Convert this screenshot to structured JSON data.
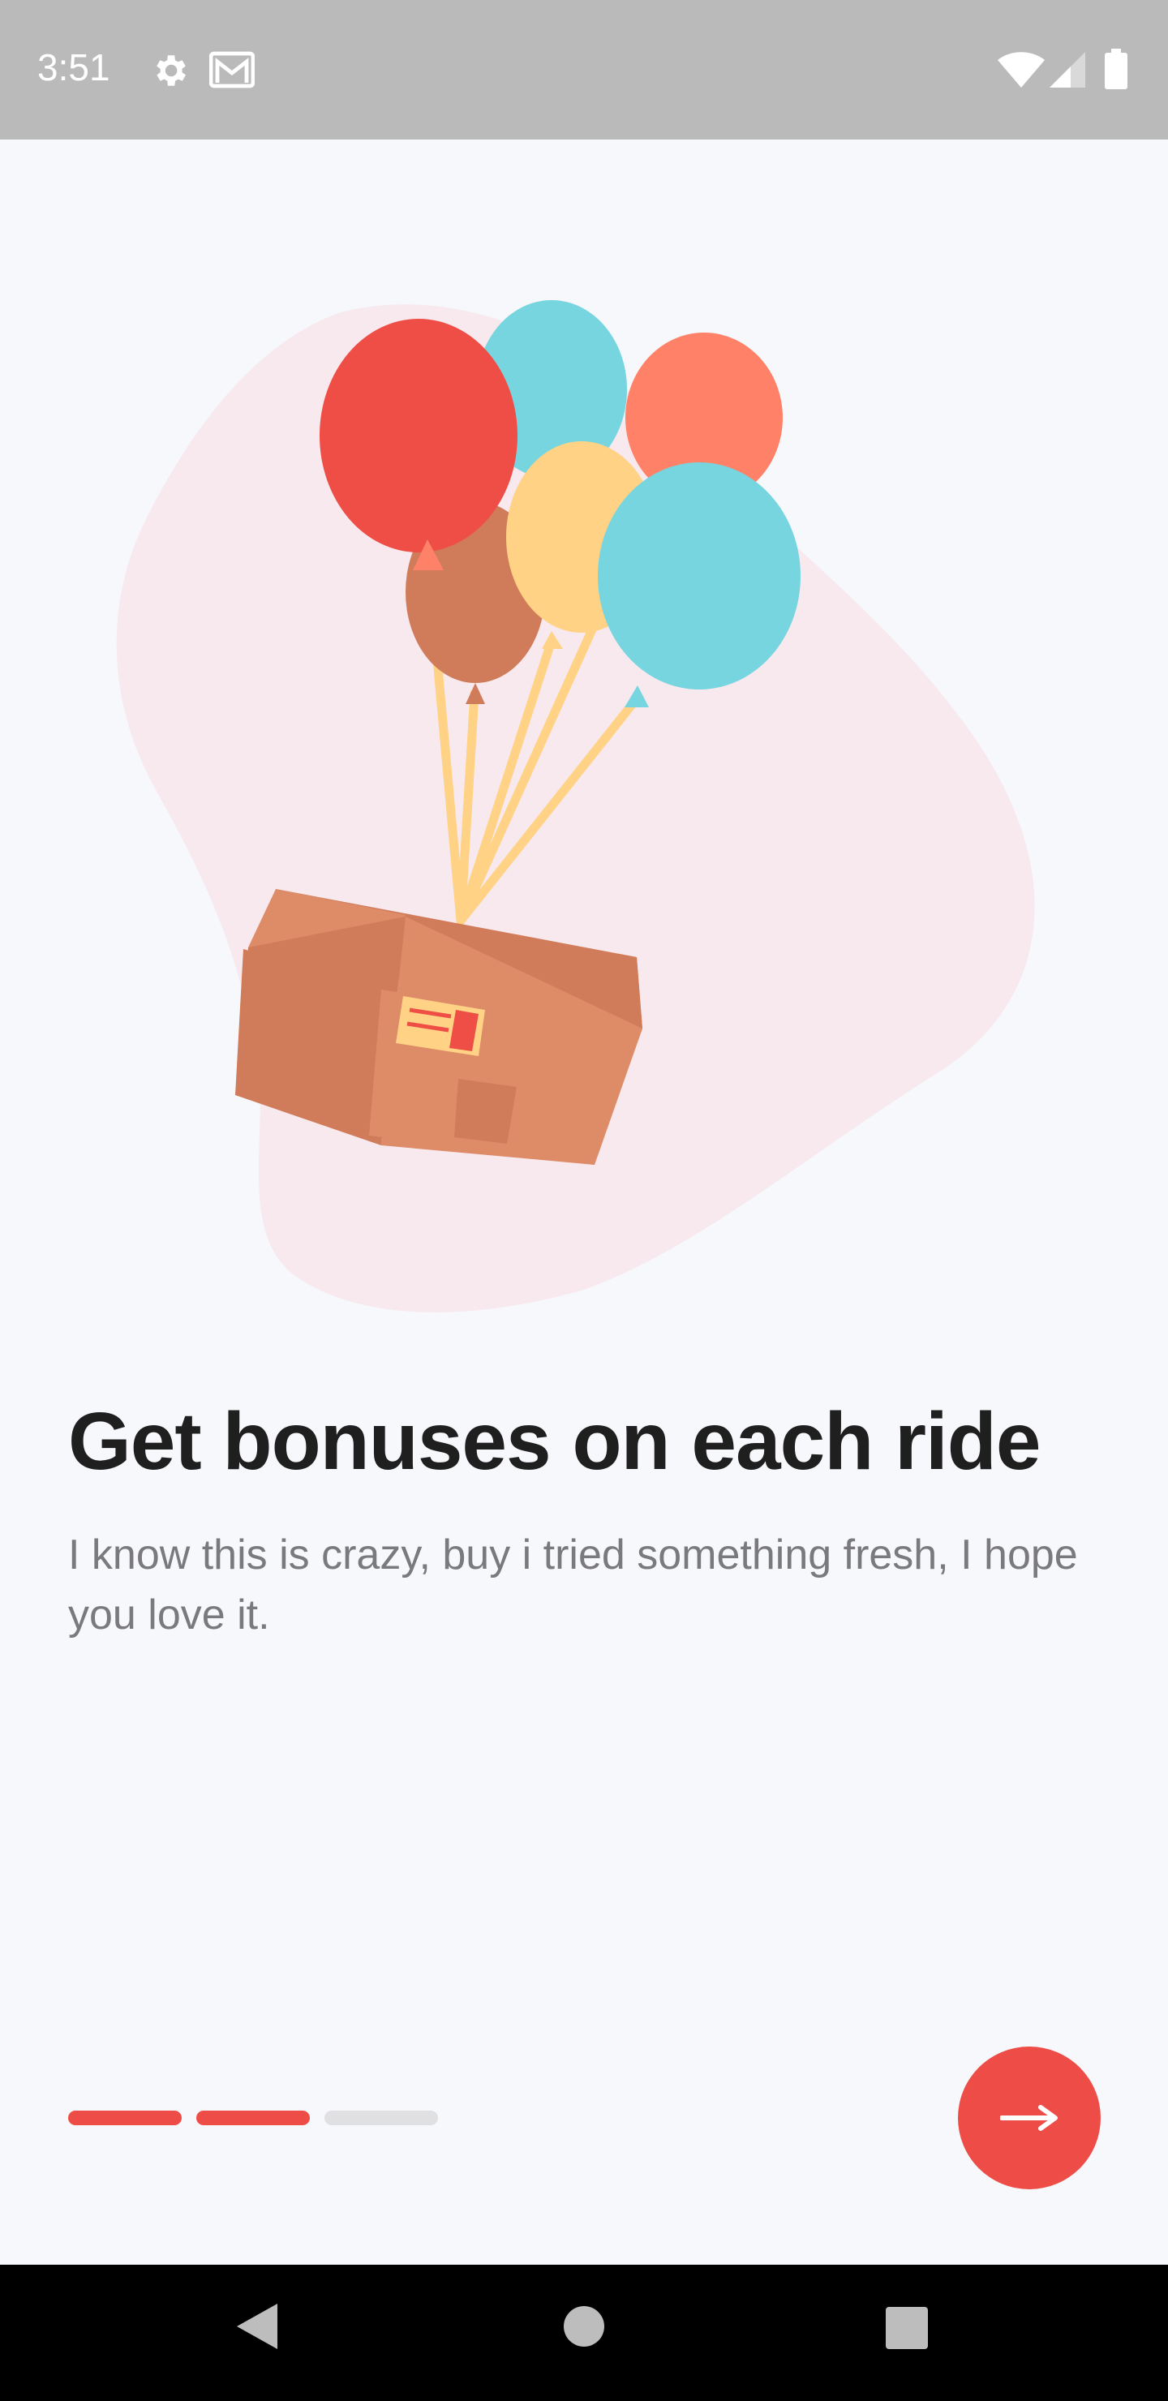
{
  "status_bar": {
    "time": "3:51",
    "icons": [
      "settings-icon",
      "gmail-icon",
      "wifi-icon",
      "signal-icon",
      "battery-icon"
    ]
  },
  "illustration": {
    "subject": "balloons-lifting-box",
    "colors": {
      "blob": "#f7e9ee",
      "balloon_red": "#ef4e47",
      "balloon_teal": "#76d5df",
      "balloon_salmon": "#ff8168",
      "balloon_yellow": "#ffd285",
      "balloon_brown": "#d07c5a",
      "box": "#de8b67"
    }
  },
  "onboarding": {
    "title": "Get bonuses on each ride",
    "description": "I know this is crazy, buy i tried something fresh, I hope you love it.",
    "page_count": 3,
    "active_pages": 2
  },
  "next_button": {
    "icon": "arrow-right-icon"
  },
  "nav_bar": {
    "icons": [
      "back-icon",
      "home-icon",
      "recents-icon"
    ]
  },
  "colors": {
    "accent": "#ee4d47",
    "background": "#f7f8fc",
    "status_bar": "#bababb",
    "inactive_indicator": "#e0e0e2"
  }
}
